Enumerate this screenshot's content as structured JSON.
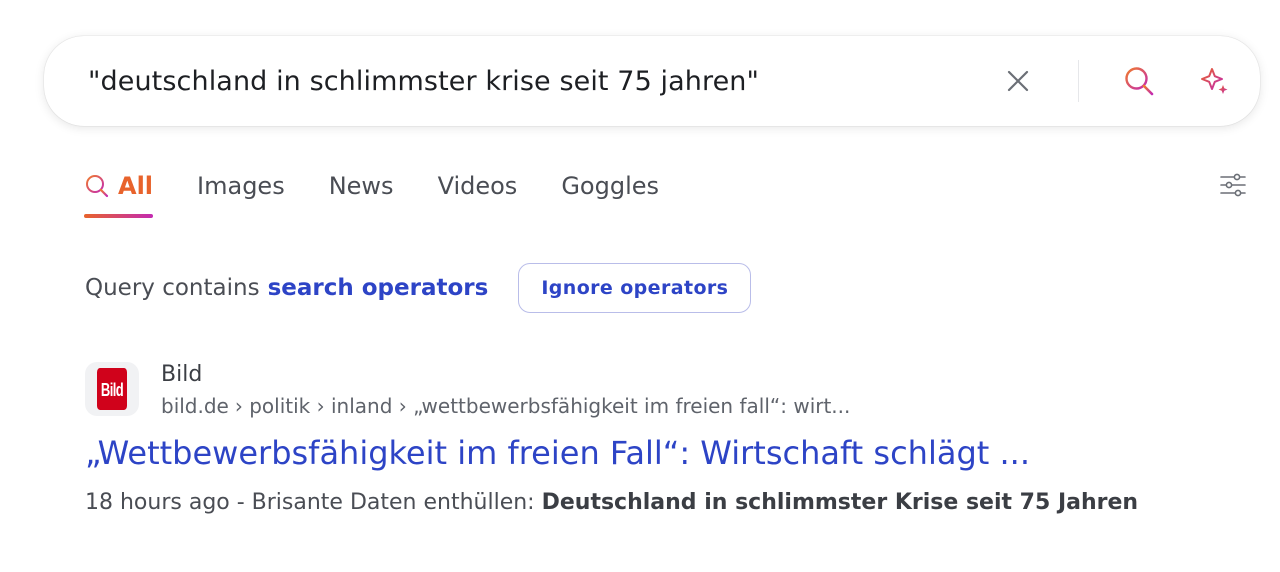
{
  "search": {
    "query": "\"deutschland in schlimmster krise seit 75 jahren\""
  },
  "icons": {
    "clear": "close-icon",
    "search": "search-icon",
    "ai": "sparkle-icon",
    "settings": "sliders-icon"
  },
  "colors": {
    "accent_orange": "#e8632c",
    "accent_magenta": "#c32ab1",
    "link_blue": "#2d44c6"
  },
  "tabs": [
    {
      "label": "All",
      "active": true
    },
    {
      "label": "Images",
      "active": false
    },
    {
      "label": "News",
      "active": false
    },
    {
      "label": "Videos",
      "active": false
    },
    {
      "label": "Goggles",
      "active": false
    }
  ],
  "operators": {
    "prefix": "Query contains",
    "link": "search operators",
    "button": "Ignore operators"
  },
  "result": {
    "favicon_text": "Bild",
    "site_name": "Bild",
    "domain": "bild.de",
    "path": "› politik › inland › „wettbewerbsfähigkeit im freien fall“: wirt...",
    "title": "„Wettbewerbsfähigkeit im freien Fall“: Wirtschaft schlägt ...",
    "snippet_time": "18 hours ago - ",
    "snippet_text": "Brisante Daten enthüllen: ",
    "snippet_bold": "Deutschland in schlimmster Krise seit 75 Jahren"
  }
}
